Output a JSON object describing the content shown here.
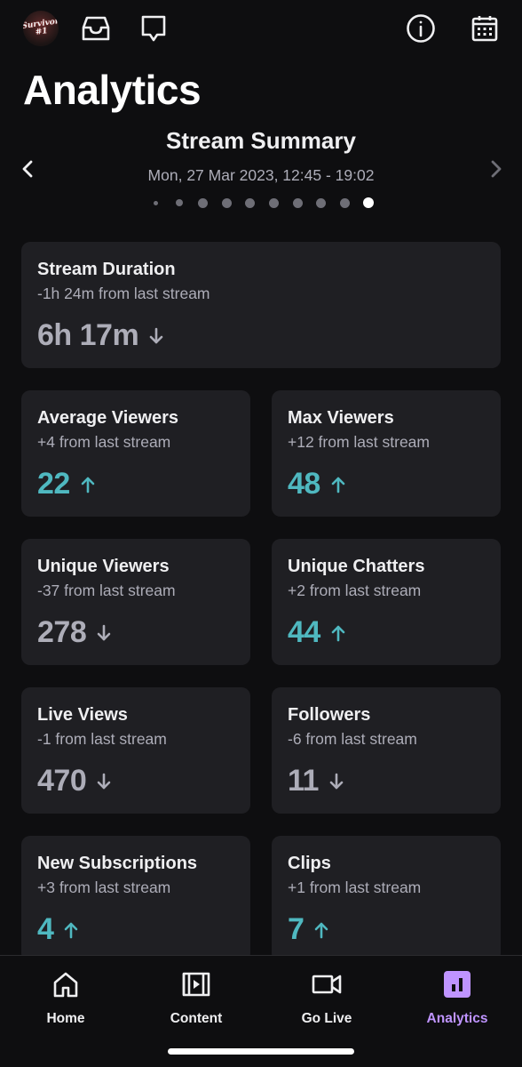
{
  "header": {
    "avatar_text": "Survivor #1",
    "page_title": "Analytics"
  },
  "summary": {
    "title": "Stream Summary",
    "date": "Mon, 27 Mar 2023, 12:45 - 19:02",
    "page_count": 10,
    "active_page": 10
  },
  "stats": [
    {
      "title": "Stream Duration",
      "sub": "-1h 24m from last stream",
      "value": "6h 17m",
      "trend": "down"
    },
    {
      "title": "Average Viewers",
      "sub": "+4 from last stream",
      "value": "22",
      "trend": "up"
    },
    {
      "title": "Max Viewers",
      "sub": "+12 from last stream",
      "value": "48",
      "trend": "up"
    },
    {
      "title": "Unique Viewers",
      "sub": "-37 from last stream",
      "value": "278",
      "trend": "down"
    },
    {
      "title": "Unique Chatters",
      "sub": "+2 from last stream",
      "value": "44",
      "trend": "up"
    },
    {
      "title": "Live Views",
      "sub": "-1 from last stream",
      "value": "470",
      "trend": "down"
    },
    {
      "title": "Followers",
      "sub": "-6 from last stream",
      "value": "11",
      "trend": "down"
    },
    {
      "title": "New Subscriptions",
      "sub": "+3 from last stream",
      "value": "4",
      "trend": "up"
    },
    {
      "title": "Clips",
      "sub": "+1 from last stream",
      "value": "7",
      "trend": "up"
    }
  ],
  "nav": {
    "items": [
      {
        "label": "Home",
        "icon": "home-icon"
      },
      {
        "label": "Content",
        "icon": "film-icon"
      },
      {
        "label": "Go Live",
        "icon": "camera-icon"
      },
      {
        "label": "Analytics",
        "icon": "bar-chart-icon"
      }
    ],
    "active": "Analytics"
  },
  "colors": {
    "background": "#0e0e10",
    "card": "#1f1f23",
    "trend_up": "#4fb8c0",
    "trend_down": "#adadb8",
    "accent": "#bf94ff"
  }
}
